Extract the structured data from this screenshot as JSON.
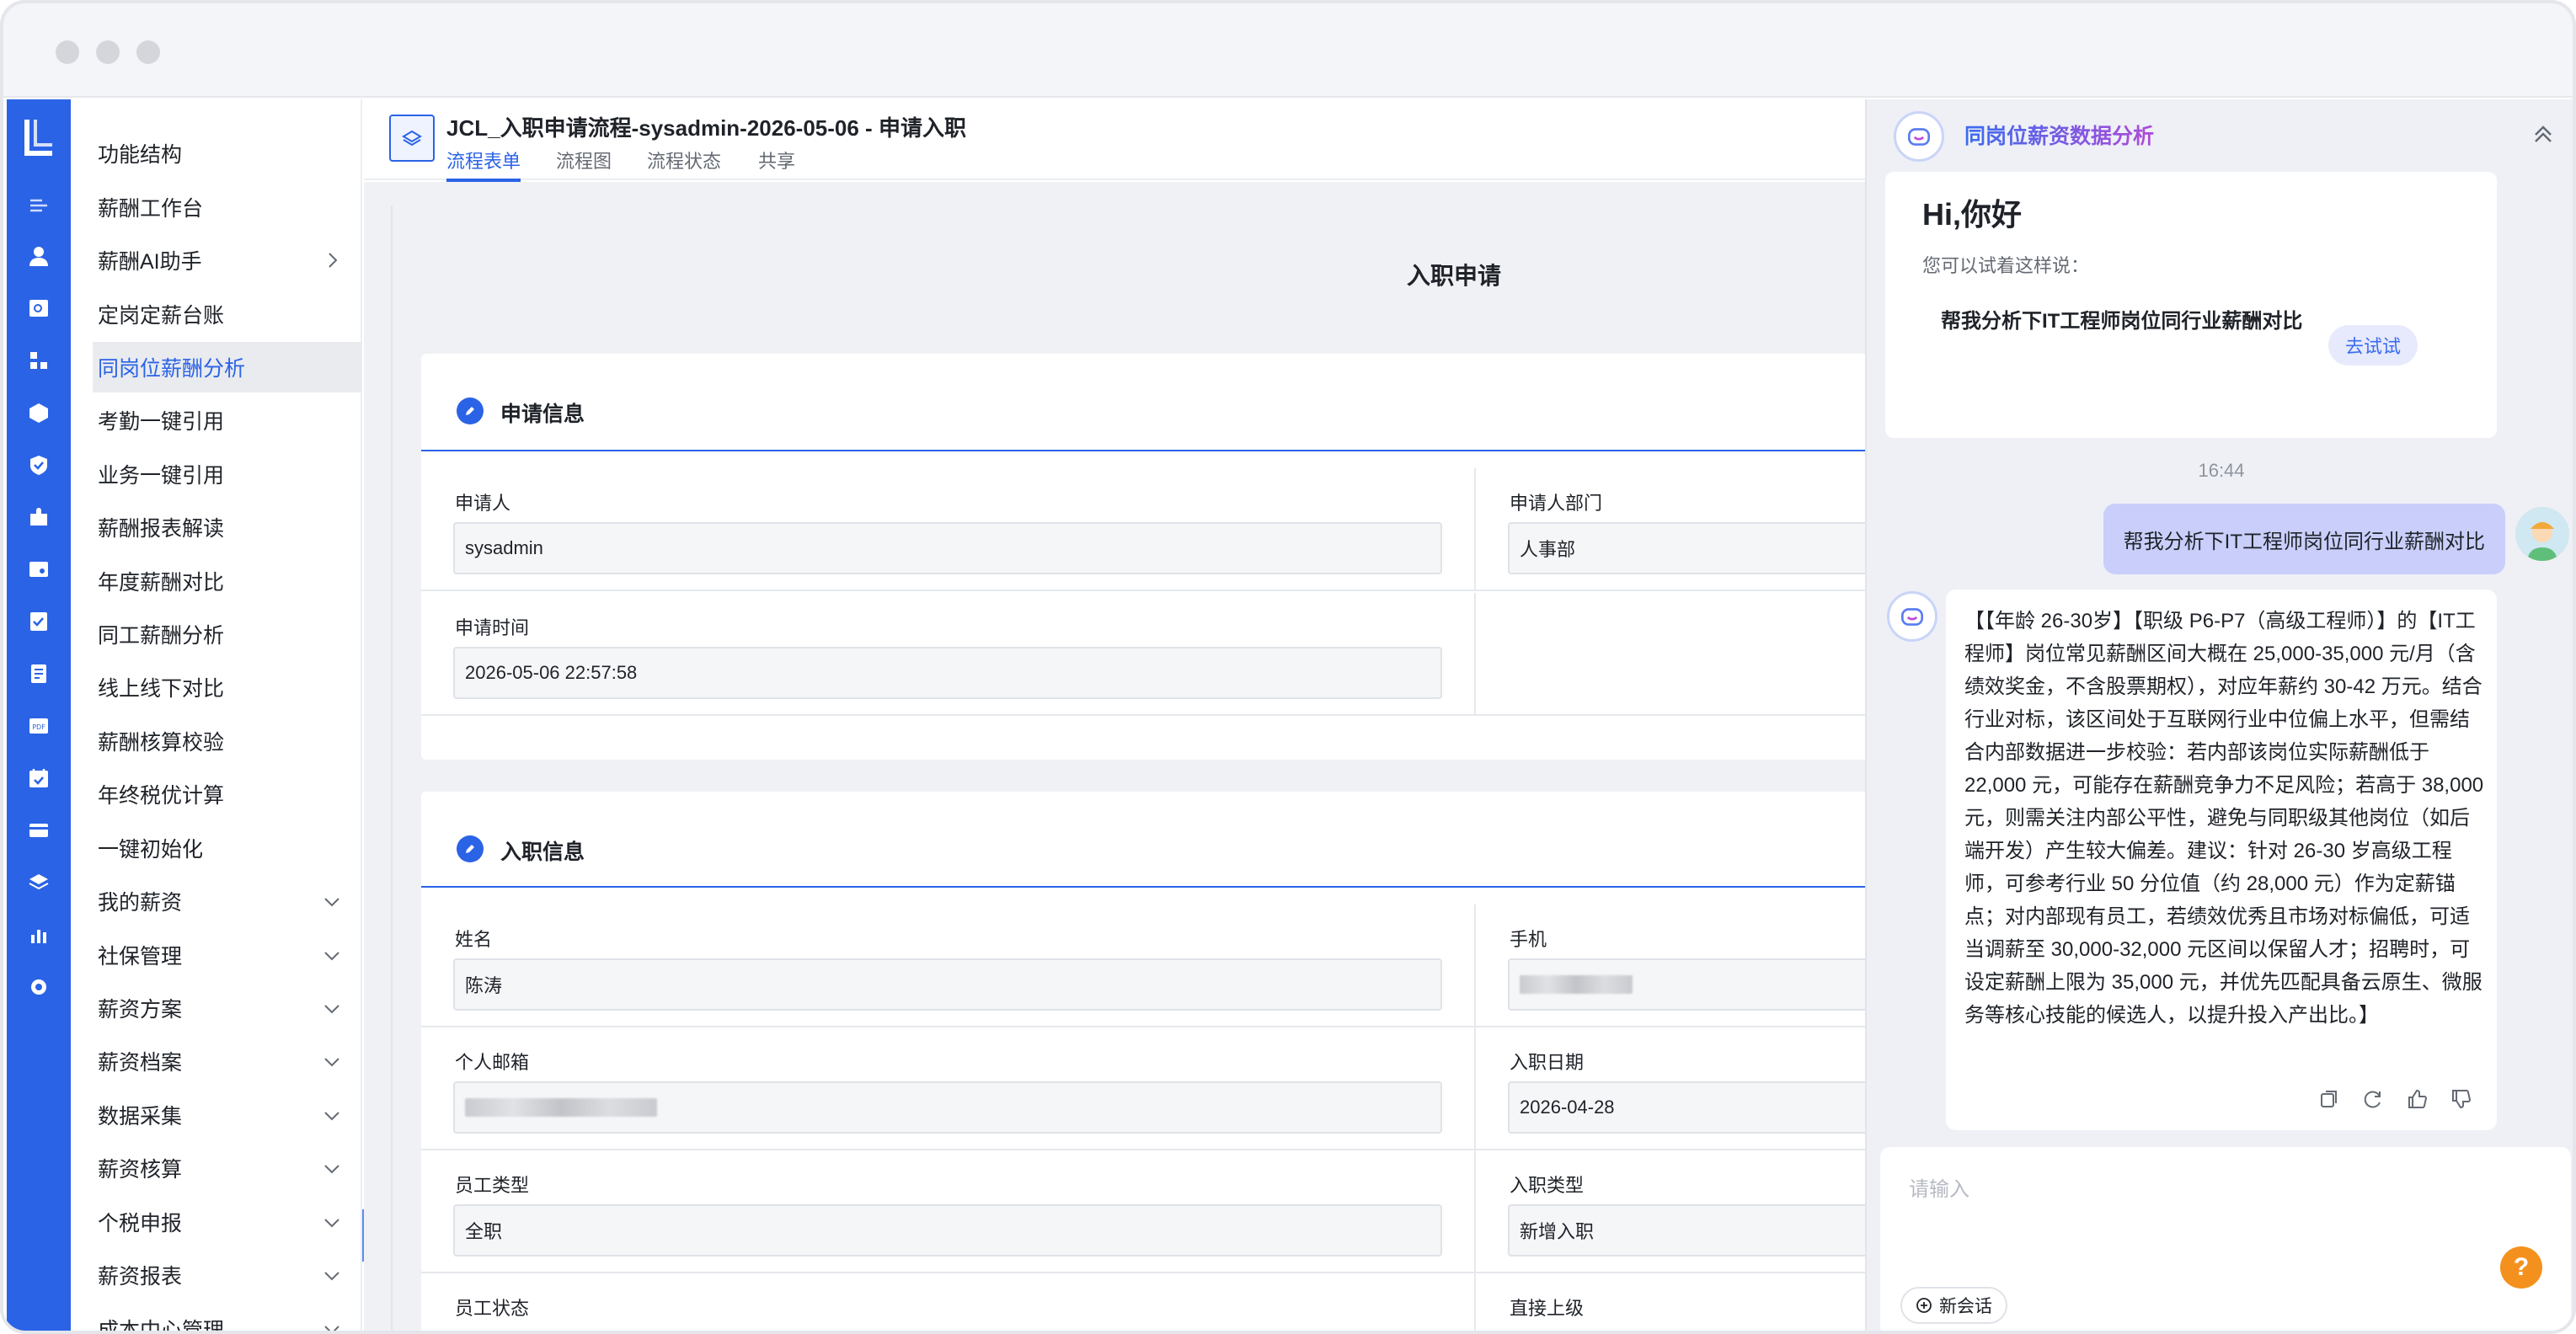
{
  "app": {
    "form_header_title": "JCL_入职申请流程-sysadmin-2026-05-06 - 申请入职",
    "tabs": [
      "流程表单",
      "流程图",
      "流程状态",
      "共享"
    ]
  },
  "menu": {
    "items": [
      {
        "label": "功能结构",
        "expandable": false
      },
      {
        "label": "薪酬工作台",
        "expandable": false
      },
      {
        "label": "薪酬AI助手",
        "expandable": "right"
      },
      {
        "label": "定岗定薪台账",
        "expandable": false
      },
      {
        "label": "同岗位薪酬分析",
        "expandable": false,
        "active": true
      },
      {
        "label": "考勤一键引用",
        "expandable": false
      },
      {
        "label": "业务一键引用",
        "expandable": false
      },
      {
        "label": "薪酬报表解读",
        "expandable": false
      },
      {
        "label": "年度薪酬对比",
        "expandable": false
      },
      {
        "label": "同工薪酬分析",
        "expandable": false
      },
      {
        "label": "线上线下对比",
        "expandable": false
      },
      {
        "label": "薪酬核算校验",
        "expandable": false
      },
      {
        "label": "年终税优计算",
        "expandable": false
      },
      {
        "label": "一键初始化",
        "expandable": false
      },
      {
        "label": "我的薪资",
        "expandable": "down"
      },
      {
        "label": "社保管理",
        "expandable": "down"
      },
      {
        "label": "薪资方案",
        "expandable": "down"
      },
      {
        "label": "薪资档案",
        "expandable": "down"
      },
      {
        "label": "数据采集",
        "expandable": "down"
      },
      {
        "label": "薪资核算",
        "expandable": "down"
      },
      {
        "label": "个税申报",
        "expandable": "down"
      },
      {
        "label": "薪资报表",
        "expandable": "down"
      },
      {
        "label": "成本中心管理",
        "expandable": "down"
      }
    ]
  },
  "form": {
    "title": "入职申请",
    "section1": {
      "title": "申请信息",
      "applicant_label": "申请人",
      "applicant_value": "sysadmin",
      "dept_label": "申请人部门",
      "dept_value": "人事部",
      "time_label": "申请时间",
      "time_value": "2026-05-06 22:57:58"
    },
    "section2": {
      "title": "入职信息",
      "name_label": "姓名",
      "name_value": "陈涛",
      "phone_label": "手机",
      "email_label": "个人邮箱",
      "entry_date_label": "入职日期",
      "entry_date_value": "2026-04-28",
      "emp_type_label": "员工类型",
      "emp_type_value": "全职",
      "entry_type_label": "入职类型",
      "entry_type_value": "新增入职",
      "emp_status_label": "员工状态",
      "supervisor_label": "直接上级"
    }
  },
  "assistant": {
    "title": "同岗位薪资数据分析",
    "greeting": "Hi,你好",
    "hint": "您可以试着这样说：",
    "suggestion": "帮我分析下IT工程师岗位同行业薪酬对比",
    "try_label": "去试试",
    "time": "16:44",
    "user_message": "帮我分析下IT工程师岗位同行业薪酬对比",
    "bot_reply": "【【年龄 26-30岁】【职级 P6-P7（高级工程师）】的【IT工程师】岗位常见薪酬区间大概在 25,000-35,000 元/月（含绩效奖金，不含股票期权），对应年薪约 30-42 万元。结合行业对标，该区间处于互联网行业中位偏上水平，但需结合内部数据进一步校验：若内部该岗位实际薪酬低于 22,000 元，可能存在薪酬竞争力不足风险；若高于 38,000 元，则需关注内部公平性，避免与同职级其他岗位（如后端开发）产生较大偏差。建议：针对 26-30 岁高级工程师，可参考行业 50 分位值（约 28,000 元）作为定薪锚点；对内部现有员工，若绩效优秀且市场对标偏低，可适当调薪至 30,000-32,000 元区间以保留人才；招聘时，可设定薪酬上限为 35,000 元，并优先匹配具备云原生、微服务等核心技能的候选人，以提升投入产出比。】",
    "input_placeholder": "请输入",
    "new_chat_label": "新会话",
    "help_label": "?"
  },
  "colors": {
    "primary": "#2b63e6",
    "rail": "#2b63e6",
    "user_bubble": "#c9cffa",
    "help": "#f4911e"
  }
}
